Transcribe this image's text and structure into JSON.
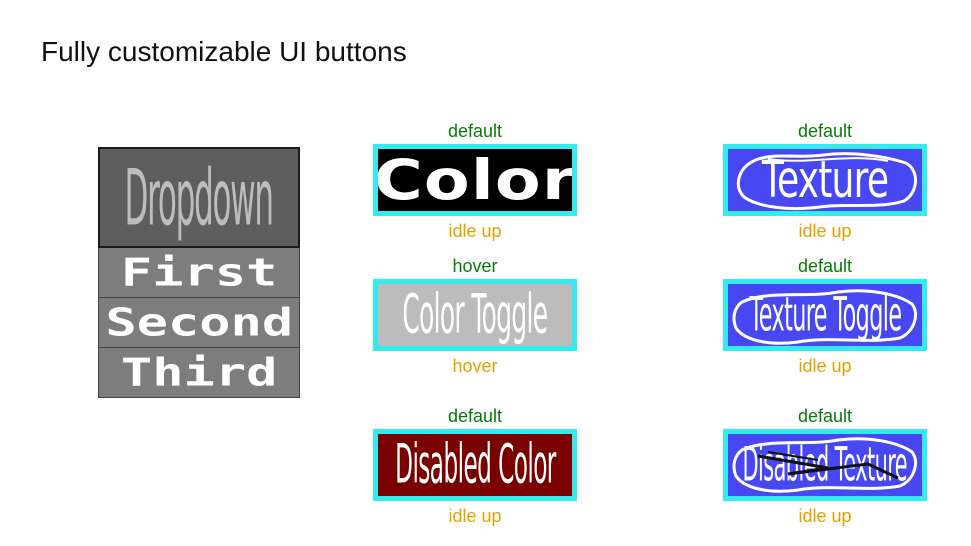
{
  "page": {
    "title": "Fully customizable UI buttons"
  },
  "dropdown": {
    "label": "Dropdown",
    "options": [
      "First",
      "Second",
      "Third"
    ]
  },
  "buttons": {
    "color": {
      "label": "Color",
      "state_top": "default",
      "state_bottom": "idle up",
      "bg": "#000000",
      "border": "#33ecef"
    },
    "color_toggle": {
      "label": "Color Toggle",
      "state_top": "hover",
      "state_bottom": "hover",
      "bg": "#bcbcbc",
      "border": "#33ecef"
    },
    "disabled_color": {
      "label": "Disabled Color",
      "state_top": "default",
      "state_bottom": "idle up",
      "bg": "#7a0000",
      "border": "#33ecef"
    },
    "texture": {
      "label": "Texture",
      "state_top": "default",
      "state_bottom": "idle up",
      "bg": "#4747f4",
      "border": "#33ecef"
    },
    "texture_toggle": {
      "label": "Texture Toggle",
      "state_top": "default",
      "state_bottom": "idle up",
      "bg": "#4747f4",
      "border": "#33ecef"
    },
    "disabled_texture": {
      "label": "Disabled Texture",
      "state_top": "default",
      "state_bottom": "idle up",
      "bg": "#4747f4",
      "border": "#33ecef"
    }
  },
  "colors": {
    "state_top": "#0a7a0a",
    "state_bottom": "#e6a000",
    "dropdown_header": "#5e5e5e",
    "dropdown_item": "#7d7d7d"
  }
}
